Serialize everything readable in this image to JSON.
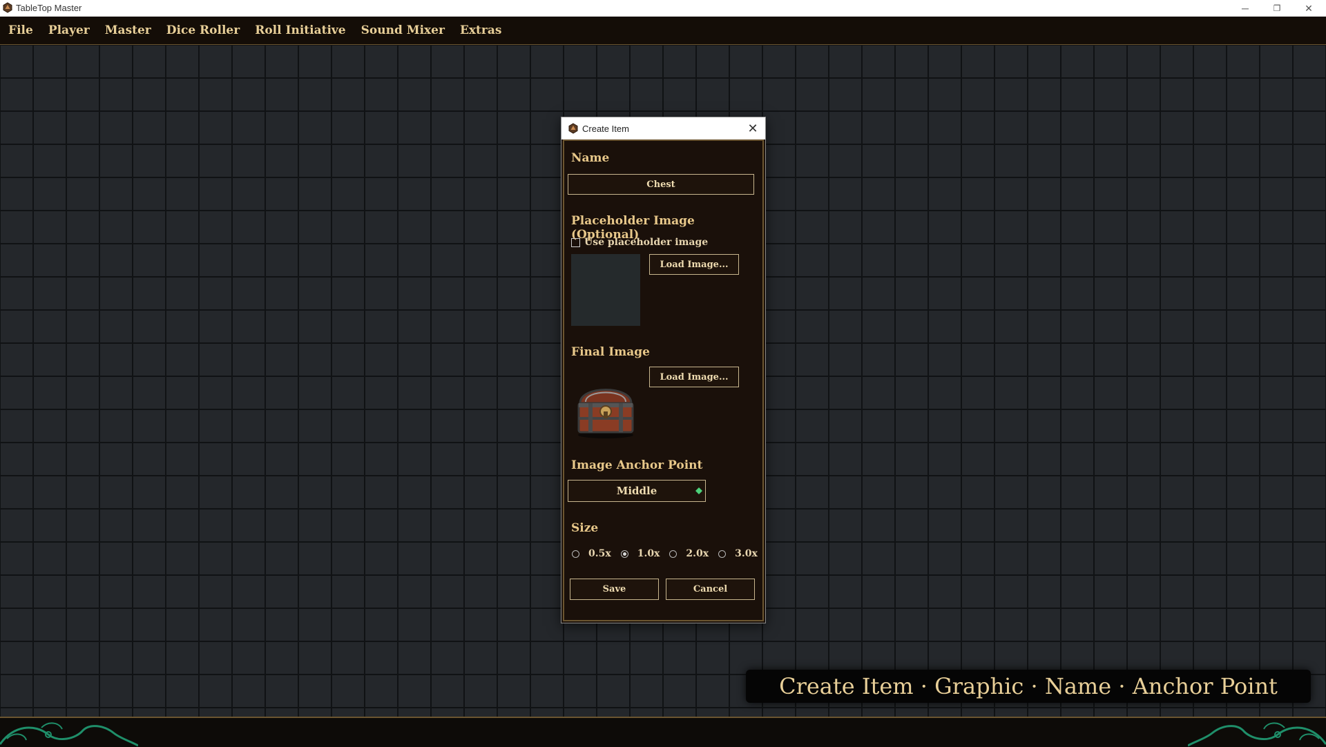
{
  "window": {
    "title": "TableTop Master",
    "controls": {
      "minimize": "─",
      "restore": "❐",
      "close": "✕"
    }
  },
  "menu": {
    "items": [
      "File",
      "Player",
      "Master",
      "Dice Roller",
      "Roll Initiative",
      "Sound Mixer",
      "Extras"
    ]
  },
  "caption": "Create Item · Graphic · Name · Anchor Point",
  "dialog": {
    "title": "Create Item",
    "close_glyph": "✕",
    "name_label": "Name",
    "name_value": "Chest",
    "placeholder_label": "Placeholder Image (Optional)",
    "use_placeholder_label": "Use placeholder image",
    "use_placeholder_checked": false,
    "load_image_label": "Load Image...",
    "final_image_label": "Final Image",
    "anchor_label": "Image Anchor Point",
    "anchor_value": "Middle",
    "size_label": "Size",
    "size_options": [
      "0.5x",
      "1.0x",
      "2.0x",
      "3.0x"
    ],
    "size_selected": "1.0x",
    "save_label": "Save",
    "cancel_label": "Cancel"
  },
  "colors": {
    "accent_gold": "#e8c88a",
    "menu_bg": "#140d07",
    "grid_bg": "#24272b",
    "ornament_green": "#1f8f6a"
  }
}
